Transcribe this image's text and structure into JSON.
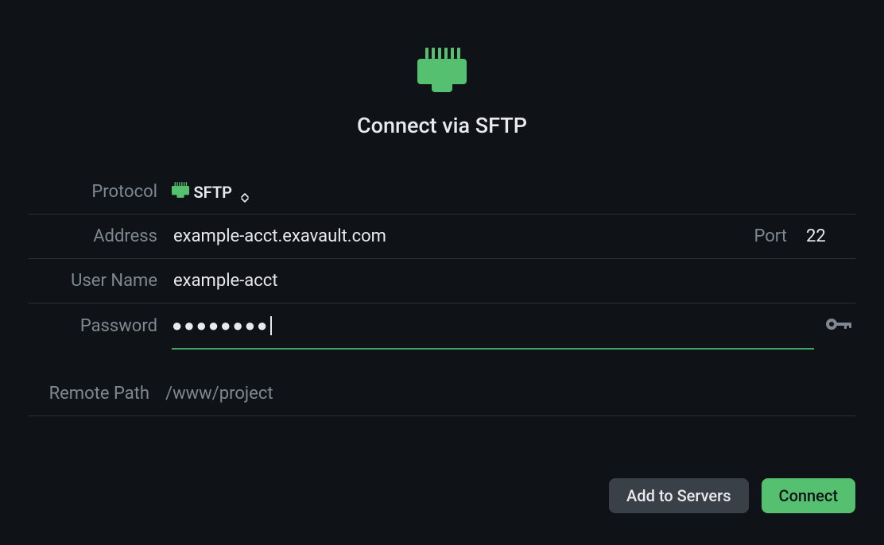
{
  "header": {
    "title": "Connect via SFTP"
  },
  "form": {
    "protocol": {
      "label": "Protocol",
      "value": "SFTP"
    },
    "address": {
      "label": "Address",
      "value": "example-acct.exavault.com"
    },
    "port": {
      "label": "Port",
      "value": "22"
    },
    "username": {
      "label": "User Name",
      "value": "example-acct"
    },
    "password": {
      "label": "Password",
      "masked": "●●●●●●●●"
    },
    "remote_path": {
      "label": "Remote Path",
      "placeholder": "/www/project"
    }
  },
  "actions": {
    "add_to_servers": "Add to Servers",
    "connect": "Connect"
  },
  "colors": {
    "accent": "#55c06f",
    "focus_underline": "#3fa65d",
    "bg": "#0f1216",
    "divider": "#2b3138",
    "muted": "#7f8891",
    "text": "#e8eaed",
    "secondary_btn": "#3a4048"
  },
  "icons": {
    "ethernet": "ethernet-icon",
    "key": "key-icon",
    "select_chevrons": "chevron-up-down-icon"
  }
}
